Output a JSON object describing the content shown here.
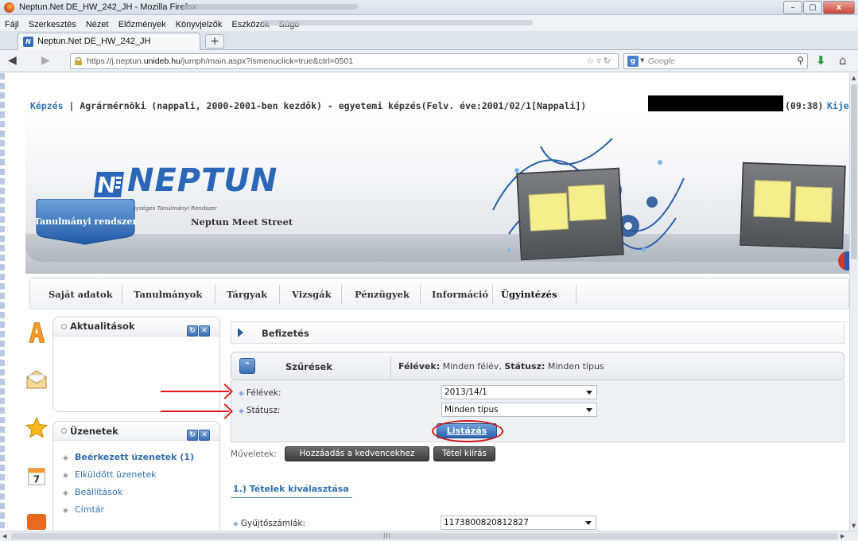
{
  "browser": {
    "window_title": "Neptun.Net DE_HW_242_JH - Mozilla Firefox",
    "menu": [
      "Fájl",
      "Szerkesztés",
      "Nézet",
      "Előzmények",
      "Könyvjelzők",
      "Eszközök",
      "Súgó"
    ],
    "tab_title": "Neptun.Net DE_HW_242_JH",
    "new_tab": "+",
    "url_prefix": "https://j.neptun.",
    "url_domain": "unideb.hu",
    "url_suffix": "/jumph/main.aspx?ismenuclick=true&ctrl=0501",
    "search_placeholder": "Google",
    "window_buttons": {
      "minimize": "–",
      "maximize": "▢",
      "close": "x"
    }
  },
  "header": {
    "crumb_link": "Képzés",
    "crumb_text": " | Agrármérnöki (nappali, 2000-2001-ben kezdők) - egyetemi képzés(Felv. éve:2001/02/1[Nappali])",
    "clock": "(09:38)",
    "logout": "Kije"
  },
  "banner": {
    "logo_name": "NEPTUN",
    "logo_subtitle": "Egységes Tanulmányi Rendszer",
    "tab_active": "Tanulmányi rendszer",
    "tab_other": "Neptun Meet Street"
  },
  "mainnav": [
    "Saját adatok",
    "Tanulmányok",
    "Tárgyak",
    "Vizsgák",
    "Pénzügyek",
    "Információ",
    "Ügyintézés"
  ],
  "sidebar": {
    "news_title": "Aktualitások",
    "messages_title": "Üzenetek",
    "messages": [
      {
        "label": "Beérkezett üzenetek (1)",
        "bold": true
      },
      {
        "label": "Elküldött üzenetek",
        "bold": false
      },
      {
        "label": "Beállítások",
        "bold": false
      },
      {
        "label": "Címtár",
        "bold": false
      }
    ],
    "box_buttons": {
      "refresh": "↻",
      "close": "✕"
    }
  },
  "content": {
    "section_title": "Befizetés",
    "filter_title": "Szűrések",
    "filter_summary_label1": "Félévek:",
    "filter_summary_value1": " Minden félév, ",
    "filter_summary_label2": "Státusz:",
    "filter_summary_value2": " Minden típus",
    "fields": [
      {
        "label": "Félévek:",
        "value": "2013/14/1"
      },
      {
        "label": "Státusz:",
        "value": "Minden típus"
      }
    ],
    "list_button": "Listázás",
    "actions_label": "Műveletek:",
    "actions": [
      "Hozzáadás a kedvencekhez",
      "Tétel kiírás"
    ],
    "subsection_title": "1.) Tételek kiválasztása",
    "collect_label": "Gyűjtőszámlák:",
    "collect_value": "1173800820812827"
  },
  "colors": {
    "link_blue": "#2f6fae",
    "neptun_blue": "#2c66b8",
    "annotation_red": "#e01818"
  }
}
